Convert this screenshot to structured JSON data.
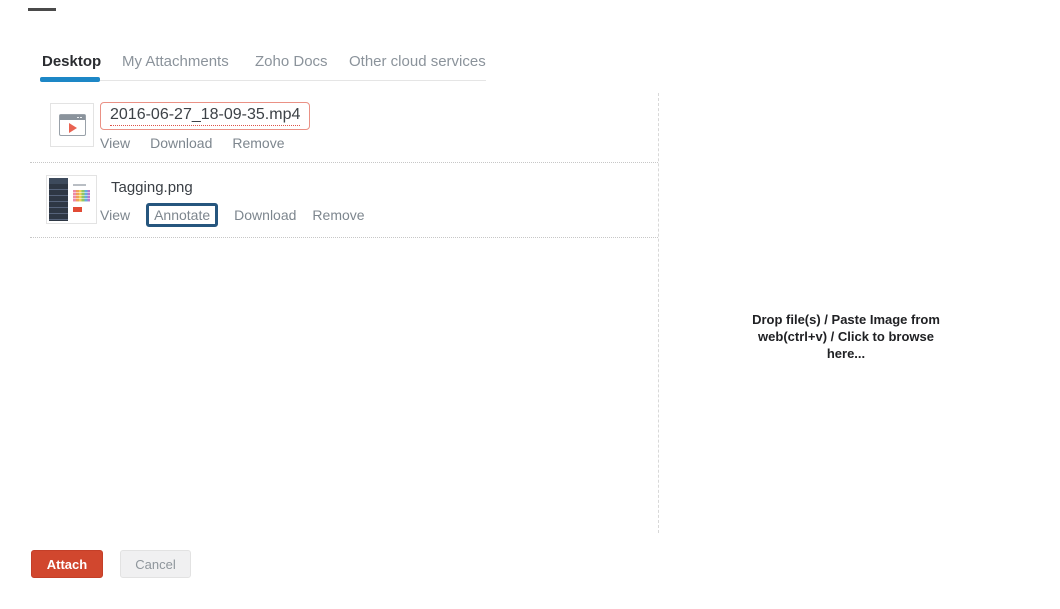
{
  "tabs": {
    "items": [
      {
        "label": "Desktop",
        "active": true
      },
      {
        "label": "My Attachments",
        "active": false
      },
      {
        "label": "Zoho Docs",
        "active": false
      },
      {
        "label": "Other cloud services",
        "active": false
      }
    ]
  },
  "files": [
    {
      "name": "2016-06-27_18-09-35.mp4",
      "kind": "video",
      "actions": {
        "view": "View",
        "download": "Download",
        "remove": "Remove"
      }
    },
    {
      "name": "Tagging.png",
      "kind": "image",
      "actions": {
        "view": "View",
        "annotate": "Annotate",
        "download": "Download",
        "remove": "Remove"
      }
    }
  ],
  "dropzone": {
    "lines": [
      "Drop file(s) / Paste Image from",
      "web(ctrl+v) / Click to browse",
      "here..."
    ]
  },
  "footer": {
    "attach": "Attach",
    "cancel": "Cancel"
  },
  "colors": {
    "accent_blue": "#1d87c6",
    "attach_red": "#d1472e",
    "filename_border_red": "#ea9185",
    "annotate_border_navy": "#26567e"
  }
}
